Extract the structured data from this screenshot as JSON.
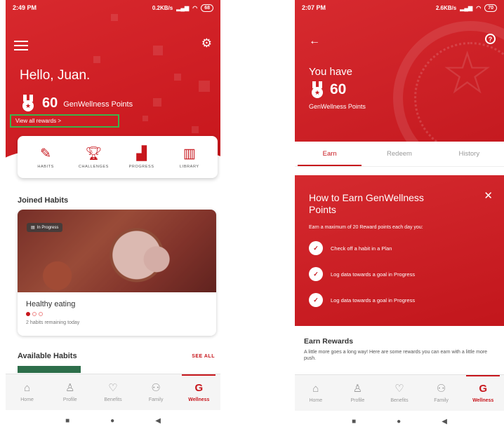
{
  "colors": {
    "brand_red": "#c7161c",
    "highlight_green": "#3cb34a"
  },
  "screen1": {
    "status": {
      "time": "2:49 PM",
      "indicators": "0.2KB/s",
      "battery": "68"
    },
    "greeting": "Hello, Juan.",
    "points": {
      "value": "60",
      "unit": "GenWellness Points"
    },
    "view_rewards": "View all rewards >",
    "quick_actions": [
      {
        "label": "HABITS",
        "icon": "habits-icon"
      },
      {
        "label": "CHALLENGES",
        "icon": "trophy-icon"
      },
      {
        "label": "PROGRESS",
        "icon": "progress-chart-icon"
      },
      {
        "label": "LIBRARY",
        "icon": "book-icon"
      }
    ],
    "joined_habits_title": "Joined Habits",
    "habit_card": {
      "badge": "In Progress",
      "name": "Healthy eating",
      "progress_dots": {
        "completed": 1,
        "total": 3
      },
      "remaining": "2 habits remaining today"
    },
    "available_habits_title": "Available Habits",
    "see_all": "SEE ALL",
    "bottom_nav": [
      {
        "label": "Home",
        "icon": "home-icon"
      },
      {
        "label": "Profile",
        "icon": "profile-icon"
      },
      {
        "label": "Benefits",
        "icon": "benefits-icon"
      },
      {
        "label": "Family",
        "icon": "family-icon"
      },
      {
        "label": "Wellness",
        "icon": "wellness-icon",
        "active": true
      }
    ]
  },
  "screen2": {
    "status": {
      "time": "2:07 PM",
      "indicators": "2.6KB/s",
      "battery": "70"
    },
    "you_have": "You have",
    "points": {
      "value": "60",
      "unit": "GenWellness Points"
    },
    "tabs": [
      {
        "label": "Earn",
        "active": true
      },
      {
        "label": "Redeem"
      },
      {
        "label": "History"
      }
    ],
    "earn_card": {
      "title": "How to Earn GenWellness Points",
      "subtitle": "Earn a maximum of 20 Reward points each day you:",
      "items": [
        "Check off a habit in a Plan",
        "Log data towards a goal in Progress",
        "Log data towards a goal in Progress"
      ]
    },
    "rewards_title": "Earn Rewards",
    "rewards_desc": "A little more goes a long way! Here are some rewards you can earn with a little more push.",
    "bottom_nav": [
      {
        "label": "Home",
        "icon": "home-icon"
      },
      {
        "label": "Profile",
        "icon": "profile-icon"
      },
      {
        "label": "Benefits",
        "icon": "benefits-icon"
      },
      {
        "label": "Family",
        "icon": "family-icon"
      },
      {
        "label": "Wellness",
        "icon": "wellness-icon",
        "active": true
      }
    ]
  }
}
